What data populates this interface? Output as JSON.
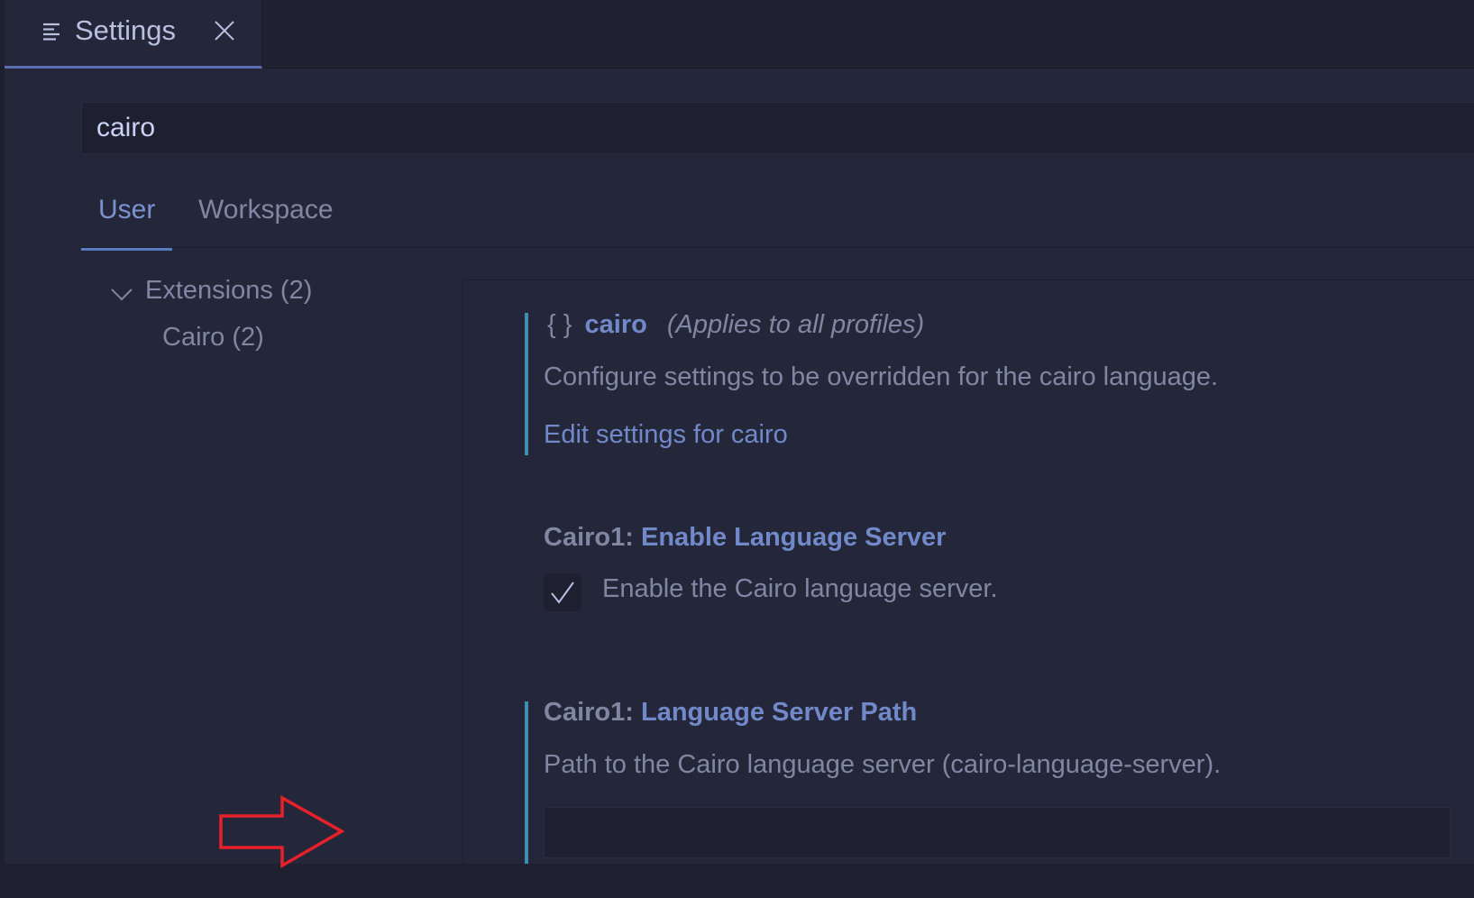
{
  "tab": {
    "title": "Settings",
    "icon": "list-icon",
    "close_icon": "close-icon"
  },
  "search": {
    "value": "cairo"
  },
  "scope_tabs": [
    {
      "label": "User",
      "active": true
    },
    {
      "label": "Workspace",
      "active": false
    }
  ],
  "tree": {
    "extensions": "Extensions (2)",
    "cairo": "Cairo (2)"
  },
  "language_section": {
    "braces": "{ }",
    "language": "cairo",
    "applies": "(Applies to all profiles)",
    "description": "Configure settings to be overridden for the cairo language.",
    "link": "Edit settings for cairo"
  },
  "settings": [
    {
      "prefix": "Cairo1: ",
      "name": "Enable Language Server",
      "description": "Enable the Cairo language server.",
      "checked": true
    },
    {
      "prefix": "Cairo1: ",
      "name": "Language Server Path",
      "description": "Path to the Cairo language server (cairo-language-server).",
      "value": ""
    }
  ],
  "annotation": {
    "color": "#e8202a",
    "shape": "arrow-right"
  },
  "colors": {
    "background": "#24273a",
    "accent": "#7289c9",
    "modified_bar": "#3e8fb0"
  }
}
